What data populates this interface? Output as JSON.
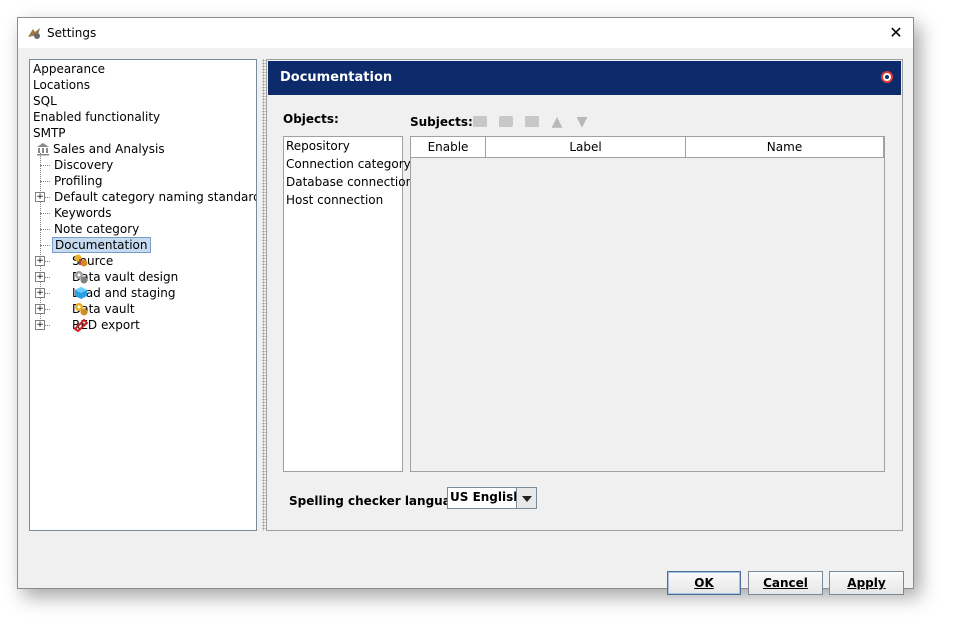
{
  "window": {
    "title": "Settings",
    "close_label": "✕",
    "app_icon": "settings-app-icon"
  },
  "tree": {
    "items": [
      {
        "label": "Appearance",
        "icon": "",
        "level": 0
      },
      {
        "label": "Locations",
        "icon": "",
        "level": 0
      },
      {
        "label": "SQL",
        "icon": "",
        "level": 0
      },
      {
        "label": "Enabled functionality",
        "icon": "",
        "level": 0
      },
      {
        "label": "SMTP",
        "icon": "",
        "level": 0
      },
      {
        "label": "Sales and Analysis",
        "icon": "bank-icon",
        "level": 0
      },
      {
        "label": "Discovery",
        "icon": "",
        "level": 1
      },
      {
        "label": "Profiling",
        "icon": "",
        "level": 1
      },
      {
        "label": "Default category naming standards",
        "icon": "",
        "level": 1,
        "expandable": true
      },
      {
        "label": "Keywords",
        "icon": "",
        "level": 1
      },
      {
        "label": "Note category",
        "icon": "",
        "level": 1
      },
      {
        "label": "Documentation",
        "icon": "",
        "level": 1,
        "selected": true
      },
      {
        "label": "Source",
        "icon": "source-icon",
        "level": 1,
        "expandable": true
      },
      {
        "label": "Data vault design",
        "icon": "gears-icon",
        "level": 1,
        "expandable": true
      },
      {
        "label": "Load and staging",
        "icon": "cube-icon",
        "level": 1,
        "expandable": true
      },
      {
        "label": "Data vault",
        "icon": "vault-icon",
        "level": 1,
        "expandable": true
      },
      {
        "label": "RED export",
        "icon": "red-export-icon",
        "level": 1,
        "expandable": true
      }
    ]
  },
  "panel": {
    "title": "Documentation",
    "help_icon": "help-icon",
    "objects_label": "Objects:",
    "objects": [
      "Repository",
      "Connection category",
      "Database connection",
      "Host connection"
    ],
    "subjects_label": "Subjects:",
    "toolbar_icons": [
      "add-subject-icon",
      "edit-subject-icon",
      "delete-subject-icon",
      "move-up-icon",
      "move-down-icon"
    ],
    "table_headers": [
      "Enable",
      "Label",
      "Name"
    ],
    "spell_label": "Spelling checker language:",
    "spell_value": "US English"
  },
  "buttons": {
    "ok": "OK",
    "cancel": "Cancel",
    "apply": "Apply"
  },
  "colors": {
    "header_bg": "#0d2a6a",
    "selection": "#c6daf0",
    "accent_red": "#e23a3a"
  }
}
